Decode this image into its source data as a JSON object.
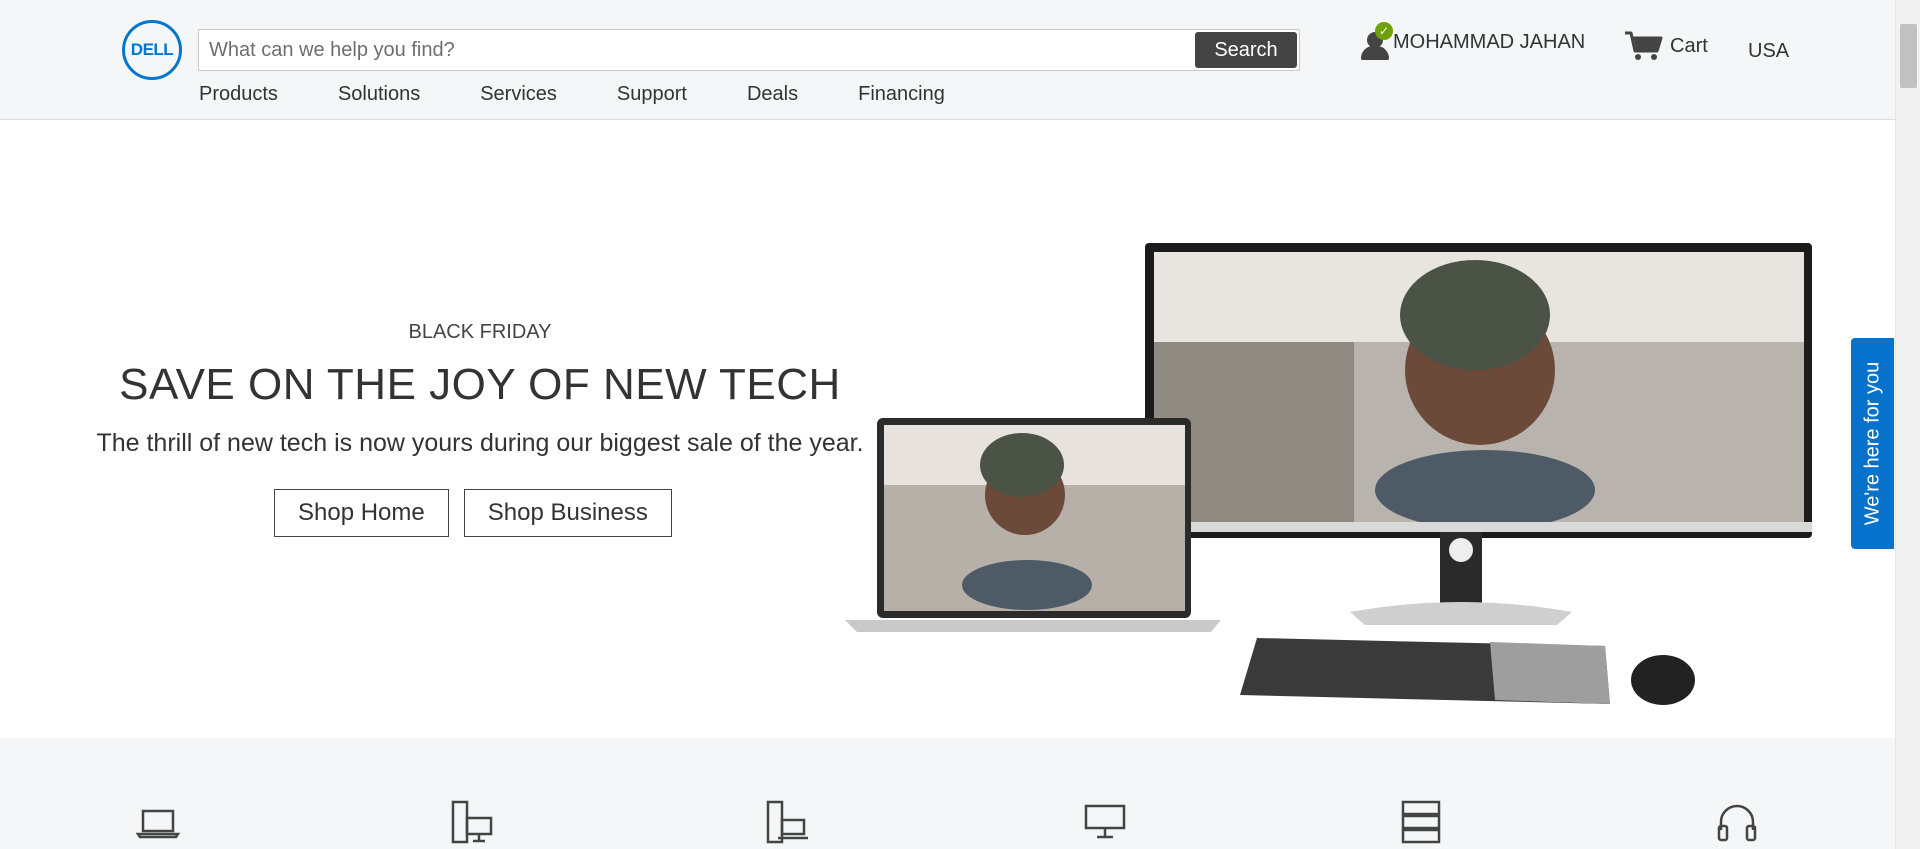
{
  "header": {
    "logo_text": "DELL",
    "search": {
      "placeholder": "What can we help you find?",
      "value": "",
      "button_label": "Search"
    },
    "nav": [
      "Products",
      "Solutions",
      "Services",
      "Support",
      "Deals",
      "Financing"
    ],
    "account": {
      "name": "MOHAMMAD JAHAN",
      "icon": "user-verified-icon"
    },
    "cart": {
      "label": "Cart",
      "icon": "cart-icon"
    },
    "country": "USA"
  },
  "hero": {
    "eyebrow": "BLACK FRIDAY",
    "title": "SAVE ON THE JOY OF NEW TECH",
    "subtitle": "The thrill of new tech is now yours during our biggest sale of the year.",
    "buttons": [
      "Shop Home",
      "Shop Business"
    ]
  },
  "help_tab": {
    "label": "We're here for you"
  },
  "categories": [
    "laptop-icon",
    "desktop-tower-icon",
    "workstation-icon",
    "monitor-icon",
    "server-icon",
    "headset-icon"
  ],
  "colors": {
    "brand": "#0076ce",
    "help_tab": "#0672cb",
    "verified": "#6ea204"
  }
}
